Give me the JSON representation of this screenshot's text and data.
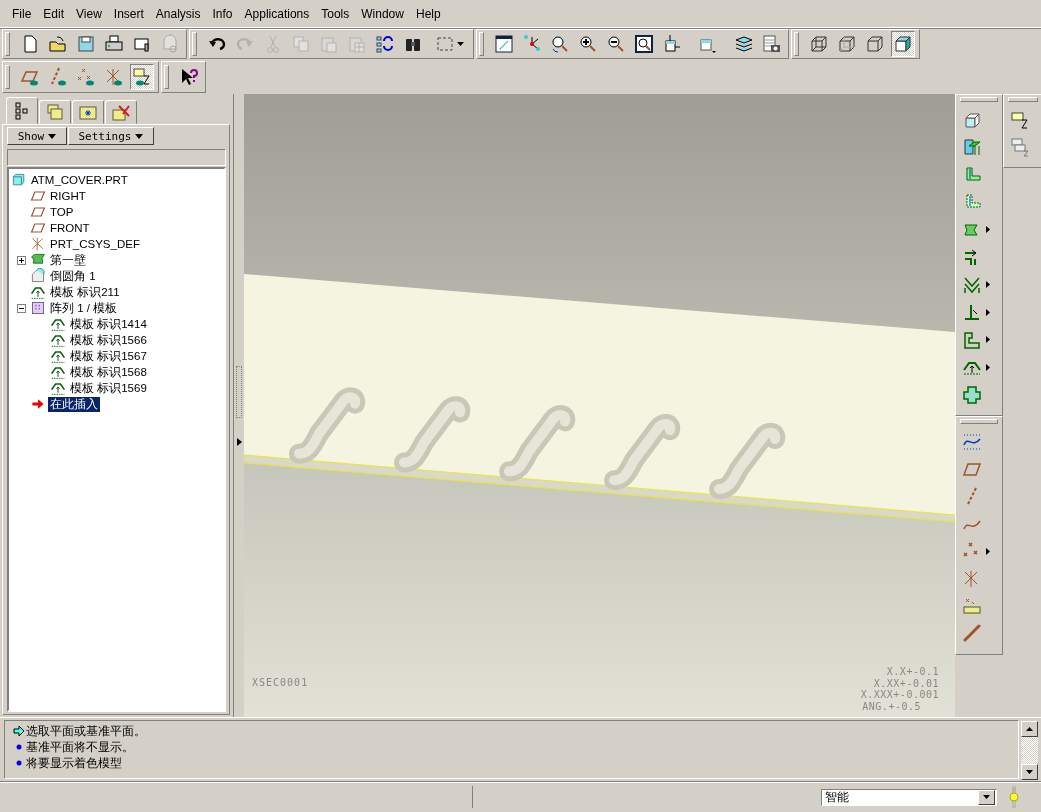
{
  "menu": [
    "File",
    "Edit",
    "View",
    "Insert",
    "Analysis",
    "Info",
    "Applications",
    "Tools",
    "Window",
    "Help"
  ],
  "toolbar_rows": [
    {
      "groups": [
        {
          "buttons": [
            {
              "kind": "new",
              "disabled": false,
              "pressed": false
            },
            {
              "kind": "open",
              "disabled": false,
              "pressed": false
            },
            {
              "kind": "save",
              "disabled": false,
              "pressed": false
            },
            {
              "kind": "print",
              "disabled": false,
              "pressed": false
            },
            {
              "kind": "mail",
              "disabled": false,
              "pressed": false
            },
            {
              "kind": "maillink",
              "disabled": true,
              "pressed": false
            }
          ]
        },
        {
          "buttons": [
            {
              "kind": "undo",
              "disabled": false,
              "pressed": false
            },
            {
              "kind": "redo",
              "disabled": true,
              "pressed": false
            },
            {
              "kind": "cut",
              "disabled": true,
              "pressed": false
            },
            {
              "kind": "copy",
              "disabled": true,
              "pressed": false
            },
            {
              "kind": "paste",
              "disabled": true,
              "pressed": false
            },
            {
              "kind": "pastespecial",
              "disabled": true,
              "pressed": false
            },
            {
              "kind": "regen",
              "disabled": false,
              "pressed": false
            },
            {
              "kind": "find",
              "disabled": false,
              "pressed": false
            },
            {
              "kind": "selectbox",
              "disabled": false,
              "pressed": false
            }
          ]
        },
        {
          "buttons": [
            {
              "kind": "repaint",
              "disabled": false,
              "pressed": false
            },
            {
              "kind": "spin",
              "disabled": false,
              "pressed": false
            },
            {
              "kind": "orient",
              "disabled": false,
              "pressed": false
            },
            {
              "kind": "zoomin",
              "disabled": false,
              "pressed": false
            },
            {
              "kind": "zoomout",
              "disabled": false,
              "pressed": false
            },
            {
              "kind": "refit",
              "disabled": false,
              "pressed": false
            },
            {
              "kind": "normal",
              "disabled": false,
              "pressed": false
            },
            {
              "kind": "views",
              "disabled": false,
              "pressed": false
            },
            {
              "kind": "layers",
              "disabled": false,
              "pressed": false
            },
            {
              "kind": "capture",
              "disabled": false,
              "pressed": false
            }
          ]
        },
        {
          "buttons": [
            {
              "kind": "wire",
              "disabled": false,
              "pressed": false
            },
            {
              "kind": "hidden",
              "disabled": false,
              "pressed": false
            },
            {
              "kind": "nohidden",
              "disabled": false,
              "pressed": false
            },
            {
              "kind": "shade",
              "disabled": false,
              "pressed": true
            }
          ]
        }
      ]
    },
    {
      "groups": [
        {
          "buttons": [
            {
              "kind": "planeeye",
              "disabled": false,
              "pressed": false
            },
            {
              "kind": "axiseye",
              "disabled": false,
              "pressed": false
            },
            {
              "kind": "pointeye",
              "disabled": false,
              "pressed": false
            },
            {
              "kind": "csyseye",
              "disabled": false,
              "pressed": false
            },
            {
              "kind": "noteeye",
              "disabled": false,
              "pressed": true
            }
          ]
        },
        {
          "buttons": [
            {
              "kind": "help",
              "disabled": false,
              "pressed": false
            }
          ]
        }
      ]
    }
  ],
  "navigator": {
    "tabs": [
      {
        "kind": "tree",
        "selected": true
      },
      {
        "kind": "folders",
        "selected": false
      },
      {
        "kind": "favorites",
        "selected": false
      },
      {
        "kind": "tools",
        "selected": false
      }
    ],
    "buttons": [
      "Show",
      "Settings"
    ]
  },
  "tree": {
    "items": [
      {
        "kind": "part",
        "label": "ATM_COVER.PRT",
        "selected": false,
        "children": [
          {
            "kind": "plane",
            "label": "RIGHT",
            "selected": false
          },
          {
            "kind": "plane",
            "label": "TOP",
            "selected": false
          },
          {
            "kind": "plane",
            "label": "FRONT",
            "selected": false
          },
          {
            "kind": "csys",
            "label": "PRT_CSYS_DEF",
            "selected": false
          },
          {
            "kind": "wall",
            "label": "第一壁",
            "selected": false,
            "expanded": false
          },
          {
            "kind": "round",
            "label": "倒圆角 1",
            "selected": false
          },
          {
            "kind": "form",
            "label": "模板 标识211",
            "selected": false
          },
          {
            "kind": "pattern",
            "label": "阵列 1 / 模板",
            "selected": false,
            "expanded": true,
            "children": [
              {
                "kind": "form",
                "label": "模板 标识1414",
                "selected": false
              },
              {
                "kind": "form",
                "label": "模板 标识1566",
                "selected": false
              },
              {
                "kind": "form",
                "label": "模板 标识1567",
                "selected": false
              },
              {
                "kind": "form",
                "label": "模板 标识1568",
                "selected": false
              },
              {
                "kind": "form",
                "label": "模板 标识1569",
                "selected": false
              }
            ]
          },
          {
            "kind": "insert",
            "label": "在此插入",
            "selected": true
          }
        ]
      }
    ]
  },
  "viewport": {
    "section_label": "XSEC0001",
    "tolerances": [
      "X.X+-0.1",
      "X.XX+-0.01",
      "X.XXX+-0.001",
      "ANG.+-0.5"
    ]
  },
  "right_toolbars": [
    {
      "buttons": [
        {
          "kind": "extrude",
          "flyout": false
        },
        {
          "kind": "flatwall",
          "flyout": false
        },
        {
          "kind": "flange",
          "flyout": false
        },
        {
          "kind": "unattached",
          "flyout": false
        },
        {
          "kind": "sheet",
          "flyout": true
        },
        {
          "kind": "extend",
          "flyout": false
        },
        {
          "kind": "bend",
          "flyout": true
        },
        {
          "kind": "unbend",
          "flyout": true
        },
        {
          "kind": "rip",
          "flyout": true
        },
        {
          "kind": "formtool",
          "flyout": true
        },
        {
          "kind": "flatpattern",
          "flyout": false
        }
      ]
    },
    {
      "buttons": [
        {
          "kind": "sketch",
          "flyout": false
        },
        {
          "kind": "dplane",
          "flyout": false
        },
        {
          "kind": "daxis",
          "flyout": false
        },
        {
          "kind": "dcurve",
          "flyout": false
        },
        {
          "kind": "dpoint",
          "flyout": true
        },
        {
          "kind": "dcsys",
          "flyout": false
        },
        {
          "kind": "danalysis",
          "flyout": false
        },
        {
          "kind": "chain",
          "flyout": false
        }
      ]
    },
    {
      "buttons": [
        {
          "kind": "note",
          "flyout": false
        },
        {
          "kind": "notes",
          "flyout": false
        }
      ]
    }
  ],
  "messages": [
    {
      "kind": "prompt",
      "text": "选取平面或基准平面。"
    },
    {
      "kind": "info",
      "text": "基准平面将不显示。"
    },
    {
      "kind": "info",
      "text": "将要显示着色模型"
    }
  ],
  "status_bar": {
    "filter": "智能"
  }
}
